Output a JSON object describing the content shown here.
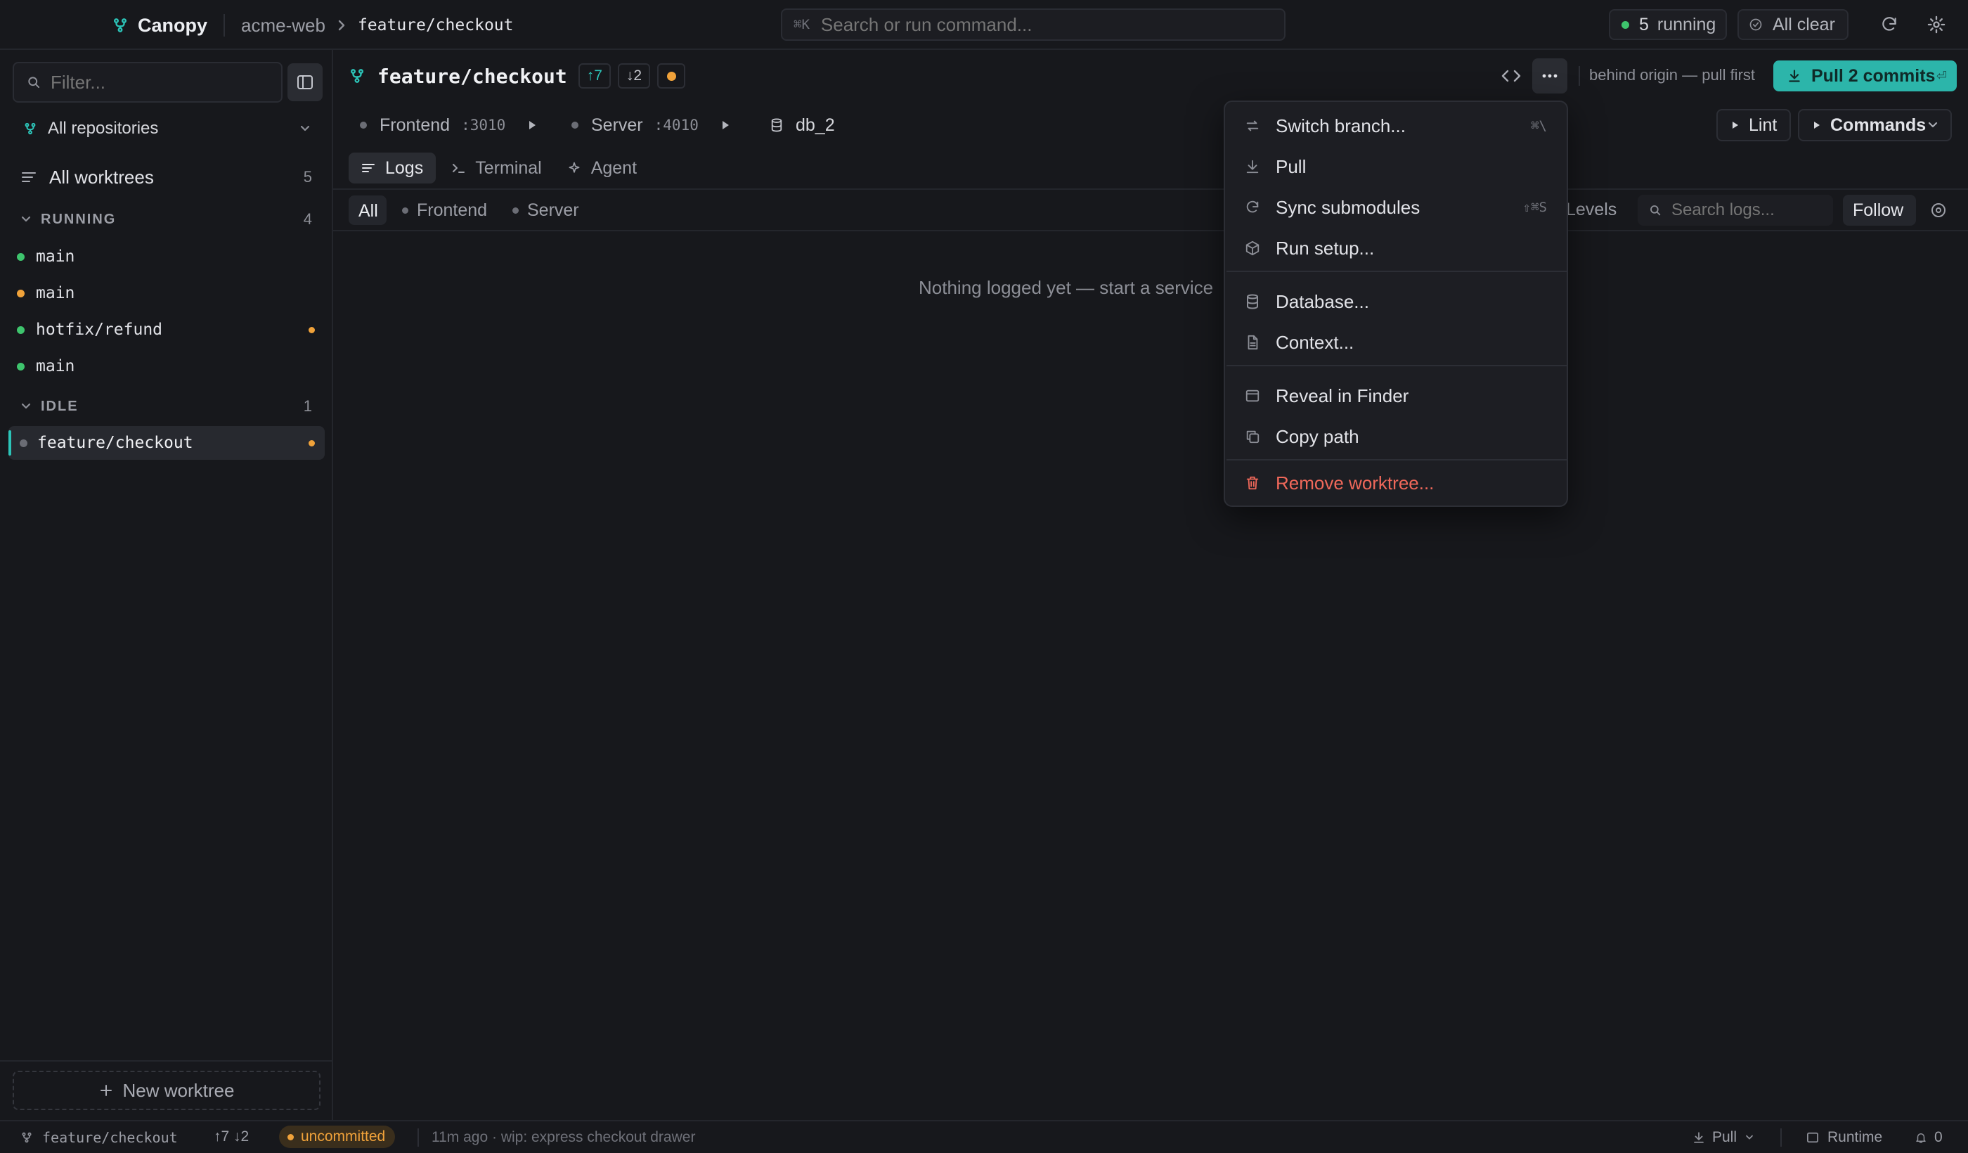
{
  "topbar": {
    "app_name": "Canopy",
    "repo": "acme-web",
    "branch": "feature/checkout",
    "search_shortcut": "⌘K",
    "search_placeholder": "Search or run command...",
    "running_count": "5",
    "running_label": "running",
    "all_clear_label": "All clear"
  },
  "sidebar": {
    "filter_placeholder": "Filter...",
    "repo_selector": "All repositories",
    "all_worktrees_label": "All worktrees",
    "all_worktrees_count": "5",
    "running_header": "RUNNING",
    "running_count": "4",
    "running_items": [
      {
        "name": "main",
        "status": "green"
      },
      {
        "name": "main",
        "status": "amber"
      },
      {
        "name": "hotfix/refund",
        "status": "green",
        "modified": true
      },
      {
        "name": "main",
        "status": "green"
      }
    ],
    "idle_header": "IDLE",
    "idle_count": "1",
    "idle_items": [
      {
        "name": "feature/checkout",
        "status": "grey",
        "modified": true,
        "selected": true
      }
    ],
    "new_worktree_label": "New worktree"
  },
  "header": {
    "branch": "feature/checkout",
    "ahead": "↑7",
    "behind": "↓2",
    "behind_notice": "behind origin — pull first",
    "pull_button": "Pull 2 commits",
    "pull_shortcut": "⏎"
  },
  "services": [
    {
      "name": "Frontend",
      "port": ":3010"
    },
    {
      "name": "Server",
      "port": ":4010"
    }
  ],
  "database": "db_2",
  "actions": {
    "lint": "Lint",
    "commands": "Commands"
  },
  "tabs": {
    "logs": "Logs",
    "terminal": "Terminal",
    "agent": "Agent"
  },
  "log_filters": {
    "all": "All",
    "frontend": "Frontend",
    "server": "Server",
    "levels": "Levels",
    "search_placeholder": "Search logs...",
    "follow": "Follow"
  },
  "empty_message": "Nothing logged yet — start a service",
  "menu": {
    "items": [
      {
        "label": "Switch branch...",
        "icon": "switch-icon",
        "shortcut": "⌘\\"
      },
      {
        "label": "Pull",
        "icon": "download-icon",
        "shortcut": ""
      },
      {
        "label": "Sync submodules",
        "icon": "refresh-icon",
        "shortcut": "⇧⌘S"
      },
      {
        "label": "Run setup...",
        "icon": "box-icon",
        "shortcut": ""
      },
      {
        "label": "Database...",
        "icon": "database-icon",
        "shortcut": ""
      },
      {
        "label": "Context...",
        "icon": "file-icon",
        "shortcut": ""
      },
      {
        "label": "Reveal in Finder",
        "icon": "window-icon",
        "shortcut": ""
      },
      {
        "label": "Copy path",
        "icon": "copy-icon",
        "shortcut": ""
      },
      {
        "label": "Remove worktree...",
        "icon": "trash-icon",
        "shortcut": ""
      }
    ]
  },
  "statusbar": {
    "branch": "feature/checkout",
    "ahead_behind": "↑7 ↓2",
    "uncommitted": "uncommitted",
    "last_commit": "11m ago · wip: express checkout drawer",
    "pull": "Pull",
    "runtime": "Runtime",
    "notifications": "0"
  },
  "colors": {
    "accent": "#2cc4b8",
    "running": "#3ec46d",
    "modified": "#f0a23a",
    "danger": "#f0685a",
    "background": "#17181c"
  }
}
